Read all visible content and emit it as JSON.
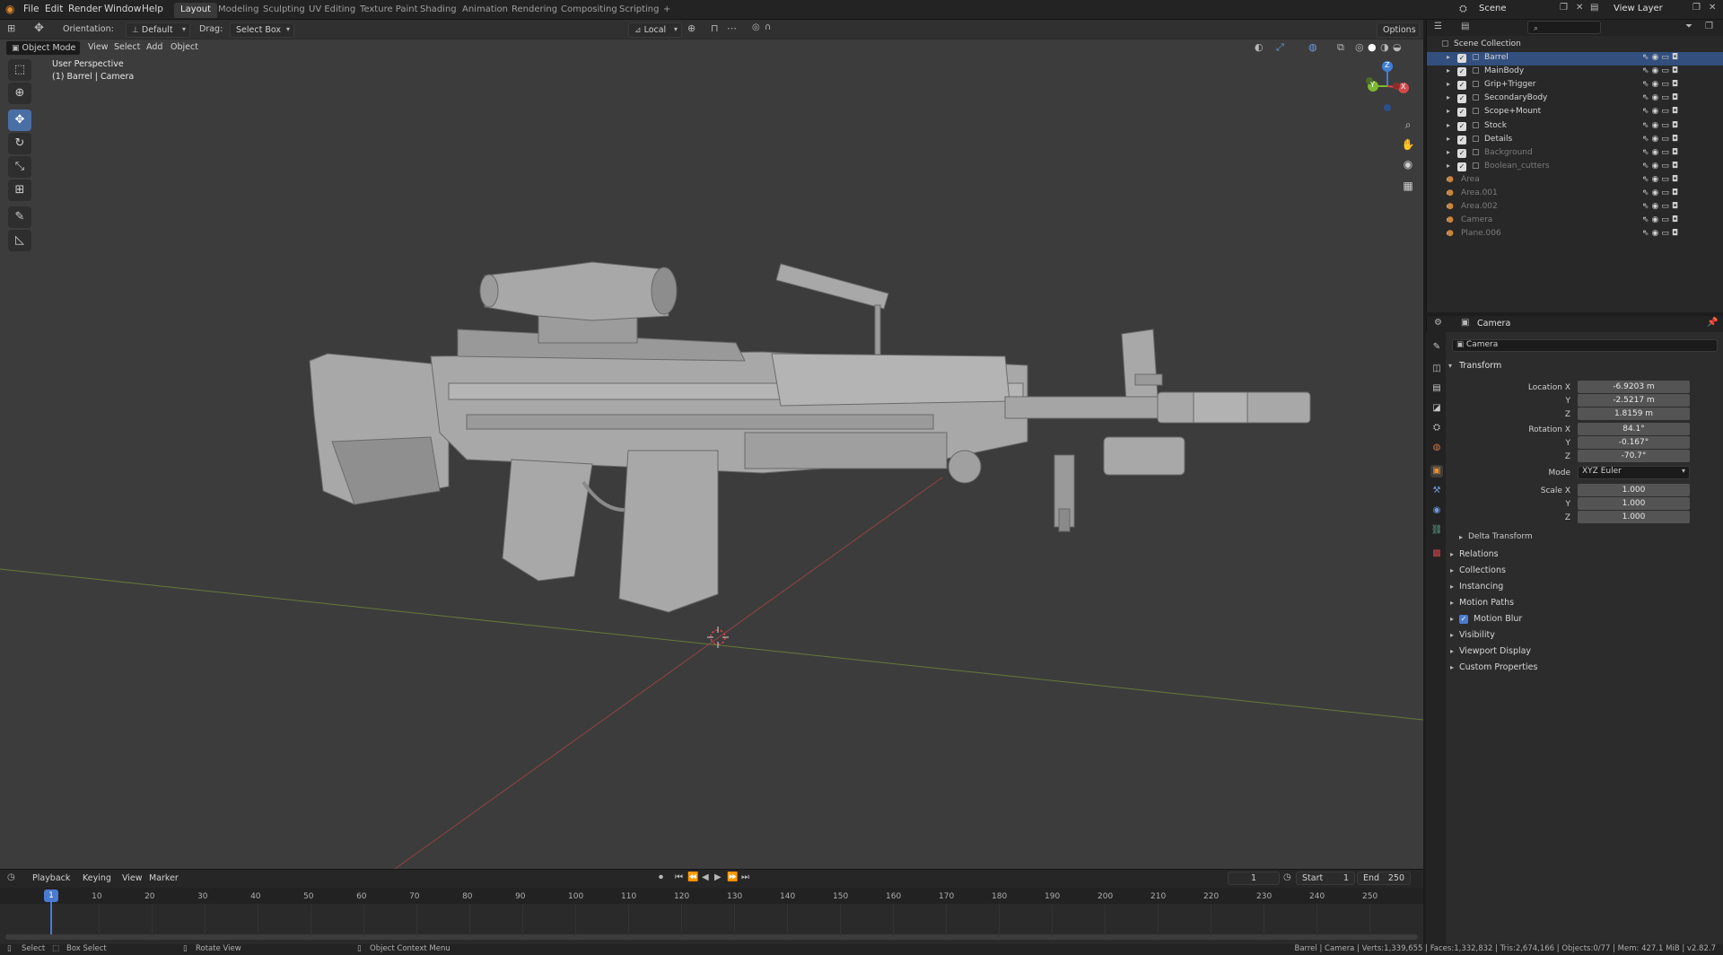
{
  "app": {
    "logo": "blender-icon",
    "menus": [
      "File",
      "Edit",
      "Render",
      "Window",
      "Help"
    ]
  },
  "workspaces": [
    "Layout",
    "Modeling",
    "Sculpting",
    "UV Editing",
    "Texture Paint",
    "Shading",
    "Animation",
    "Rendering",
    "Compositing",
    "Scripting",
    "+"
  ],
  "scene": {
    "name": "Scene",
    "view_layer": "View Layer"
  },
  "header": {
    "orientation_label": "Orientation:",
    "orientation_value": "Default",
    "drag_label": "Drag:",
    "drag_value": "Select Box",
    "pivot_value": "Local",
    "options_label": "Options"
  },
  "viewport": {
    "mode": "Object Mode",
    "menus": [
      "View",
      "Select",
      "Add",
      "Object"
    ],
    "overlay_title": "User Perspective",
    "overlay_subtitle": "(1) Barrel | Camera",
    "axes": {
      "x": "X",
      "y": "Y",
      "z": "Z"
    }
  },
  "toolbar": [
    "select-box-icon",
    "cursor-icon",
    "move-icon",
    "rotate-icon",
    "scale-icon",
    "transform-icon",
    "annotate-icon",
    "measure-icon"
  ],
  "outliner": {
    "root": "Scene Collection",
    "items": [
      {
        "name": "Barrel",
        "selected": true,
        "dim": false,
        "checked": true
      },
      {
        "name": "MainBody",
        "selected": false,
        "dim": false,
        "checked": true
      },
      {
        "name": "Grip+Trigger",
        "selected": false,
        "dim": false,
        "checked": true
      },
      {
        "name": "SecondaryBody",
        "selected": false,
        "dim": false,
        "checked": true
      },
      {
        "name": "Scope+Mount",
        "selected": false,
        "dim": false,
        "checked": true
      },
      {
        "name": "Stock",
        "selected": false,
        "dim": false,
        "checked": true
      },
      {
        "name": "Details",
        "selected": false,
        "dim": false,
        "checked": true
      },
      {
        "name": "Background",
        "selected": false,
        "dim": true,
        "checked": true
      },
      {
        "name": "Boolean_cutters",
        "selected": false,
        "dim": true,
        "checked": true
      },
      {
        "name": "Area",
        "selected": false,
        "dim": true,
        "checked": false
      },
      {
        "name": "Area.001",
        "selected": false,
        "dim": true,
        "checked": false
      },
      {
        "name": "Area.002",
        "selected": false,
        "dim": true,
        "checked": false
      },
      {
        "name": "Camera",
        "selected": false,
        "dim": true,
        "checked": false
      },
      {
        "name": "Plane.006",
        "selected": false,
        "dim": true,
        "checked": false
      }
    ]
  },
  "properties": {
    "object_name": "Camera",
    "datablock_name": "Camera",
    "transform_label": "Transform",
    "location_label": "Location X",
    "location": [
      "-6.9203 m",
      "-2.5217 m",
      "1.8159 m"
    ],
    "rotation_label": "Rotation X",
    "rotation": [
      "84.1°",
      "-0.167°",
      "-70.7°"
    ],
    "mode_label": "Mode",
    "mode_value": "XYZ Euler",
    "scale_label": "Scale X",
    "scale": [
      "1.000",
      "1.000",
      "1.000"
    ],
    "y_label": "Y",
    "z_label": "Z",
    "delta_label": "Delta Transform",
    "panels": [
      "Relations",
      "Collections",
      "Instancing",
      "Motion Paths",
      "Motion Blur",
      "Visibility",
      "Viewport Display",
      "Custom Properties"
    ]
  },
  "timeline": {
    "menus": [
      "Playback",
      "Keying",
      "View",
      "Marker"
    ],
    "current_frame": "1",
    "start_label": "Start",
    "start": "1",
    "end_label": "End",
    "end": "250",
    "ticks": [
      "1",
      "10",
      "20",
      "30",
      "40",
      "50",
      "60",
      "70",
      "80",
      "90",
      "100",
      "110",
      "120",
      "130",
      "140",
      "150",
      "160",
      "170",
      "180",
      "190",
      "200",
      "210",
      "220",
      "230",
      "240",
      "250"
    ]
  },
  "status": {
    "select": "Select",
    "box_select": "Box Select",
    "rotate_view": "Rotate View",
    "context_menu": "Object Context Menu",
    "stats": "Barrel | Camera | Verts:1,339,655 | Faces:1,332,832 | Tris:2,674,166 | Objects:0/77 | Mem: 427.1 MiB | v2.82.7"
  },
  "colors": {
    "accent": "#4a6fa5",
    "selection": "#324f7e",
    "model": "#a9a9a9",
    "x_axis": "#d44a4a",
    "y_axis": "#7bb82f",
    "z_axis": "#3f7fd6"
  }
}
